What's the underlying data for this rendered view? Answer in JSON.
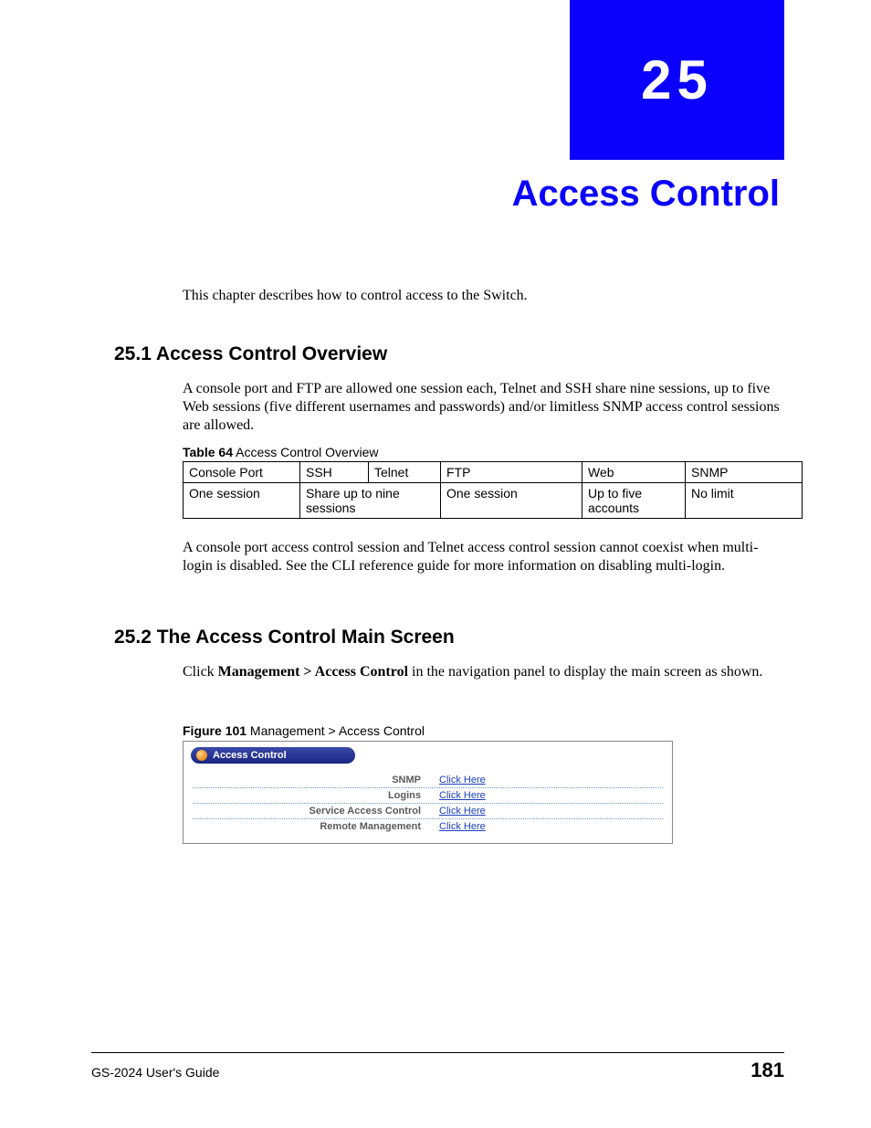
{
  "chapter": {
    "number": "25",
    "title": "Access Control",
    "intro": "This chapter describes how to control access to the Switch."
  },
  "section1": {
    "heading": "25.1  Access Control Overview",
    "p1": "A console port and FTP are allowed one session each, Telnet and SSH share nine sessions, up to five Web sessions (five different usernames and passwords) and/or limitless SNMP access control sessions are allowed.",
    "table_caption_bold": "Table 64",
    "table_caption_rest": "   Access Control Overview",
    "table": {
      "headers": [
        "Console Port",
        "SSH",
        "Telnet",
        "FTP",
        "Web",
        "SNMP"
      ],
      "row": [
        "One session",
        "Share up to nine sessions",
        "One session",
        "Up to five accounts",
        "No limit"
      ]
    },
    "p2": "A console port access control session and Telnet access control session cannot coexist when multi-login is disabled. See the CLI reference guide for more information on disabling multi-login."
  },
  "section2": {
    "heading": "25.2  The Access Control Main Screen",
    "p1_pre": "Click ",
    "p1_bold": "Management > Access Control",
    "p1_post": " in the navigation panel to display the main screen as shown.",
    "figure_caption_bold": "Figure 101",
    "figure_caption_rest": "   Management > Access Control",
    "figure": {
      "panel_title": "Access Control",
      "rows": [
        {
          "label": "SNMP",
          "link": "Click Here"
        },
        {
          "label": "Logins",
          "link": "Click Here"
        },
        {
          "label": "Service Access Control",
          "link": "Click Here"
        },
        {
          "label": "Remote Management",
          "link": "Click Here"
        }
      ]
    }
  },
  "footer": {
    "guide": "GS-2024 User's Guide",
    "page": "181"
  }
}
